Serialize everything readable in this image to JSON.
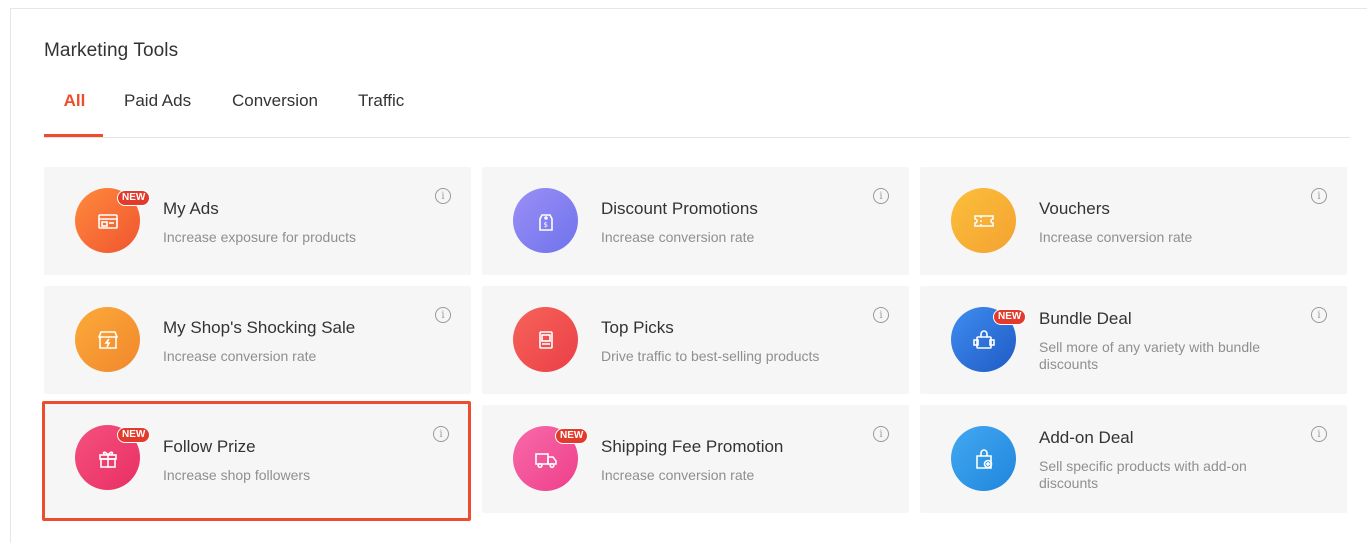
{
  "page": {
    "title": "Marketing Tools"
  },
  "tabs": [
    {
      "label": "All",
      "active": true
    },
    {
      "label": "Paid Ads",
      "active": false
    },
    {
      "label": "Conversion",
      "active": false
    },
    {
      "label": "Traffic",
      "active": false
    }
  ],
  "badge_text": "NEW",
  "info_glyph": "i",
  "cards": [
    {
      "title": "My Ads",
      "description": "Increase exposure for products",
      "icon": "ads-icon",
      "color": "#f26b3a",
      "new": true
    },
    {
      "title": "Discount Promotions",
      "description": "Increase conversion rate",
      "icon": "price-tag-icon",
      "color": "#7f7ff0",
      "new": false
    },
    {
      "title": "Vouchers",
      "description": "Increase conversion rate",
      "icon": "voucher-icon",
      "color": "#f7b035",
      "new": false
    },
    {
      "title": "My Shop's Shocking Sale",
      "description": "Increase conversion rate",
      "icon": "shop-flash-icon",
      "color": "#f59a2f",
      "new": false
    },
    {
      "title": "Top Picks",
      "description": "Drive traffic to best-selling products",
      "icon": "top-picks-icon",
      "color": "#f1504e",
      "new": false
    },
    {
      "title": "Bundle Deal",
      "description": "Sell more of any variety with bundle discounts",
      "icon": "bundle-icon",
      "color": "#2f73d8",
      "new": true
    },
    {
      "title": "Follow Prize",
      "description": "Increase shop followers",
      "icon": "gift-icon",
      "color": "#ef3f6e",
      "new": true,
      "selected": true
    },
    {
      "title": "Shipping Fee Promotion",
      "description": "Increase conversion rate",
      "icon": "truck-icon",
      "color": "#f2559c",
      "new": true
    },
    {
      "title": "Add-on Deal",
      "description": "Sell specific products with add-on discounts",
      "icon": "add-on-bag-icon",
      "color": "#2f95e6",
      "new": false
    }
  ]
}
